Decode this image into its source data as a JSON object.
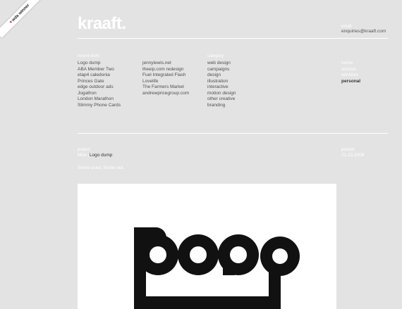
{
  "badge": {
    "heart": "♥",
    "label": "wda winner"
  },
  "brand": {
    "logo": "kraaft."
  },
  "contact": {
    "label": "email",
    "value": "enquiries@kraaft.com"
  },
  "recent": {
    "label": "recent work",
    "col1": [
      "Logo dump",
      "ABA Member Two",
      "etap4 caledonia",
      "Princes Gate",
      "edge outdoor ads",
      "Jogathon",
      "London Marathon",
      "Slimmy Phone Cards"
    ],
    "col2": [
      "jennylewis.net",
      "theeip.com redesign",
      "Fuel Integrated Flash",
      "Lovelife",
      "The Farmers Market",
      "andrewpricegroup.com"
    ]
  },
  "category": {
    "label": "category",
    "items": [
      "web design",
      "campaigns",
      "design",
      "illustration",
      "interactive",
      "motion design",
      "other creative",
      "branding"
    ]
  },
  "nav": {
    "items": [
      {
        "label": "home",
        "active": false
      },
      {
        "label": "archive",
        "active": false
      },
      {
        "label": "services",
        "active": false
      },
      {
        "label": "personal",
        "active": true
      }
    ]
  },
  "project": {
    "label": "project",
    "breadcrumb_prefix": "Misc |",
    "title": "Logo dump",
    "description": "Some used. Some not."
  },
  "posted": {
    "label": "posted",
    "date": "21.10.2008"
  },
  "colors": {
    "background": "#e3e3e3",
    "accent": "#ffffff",
    "text": "#4a4a4a",
    "heart": "#d0286c"
  }
}
